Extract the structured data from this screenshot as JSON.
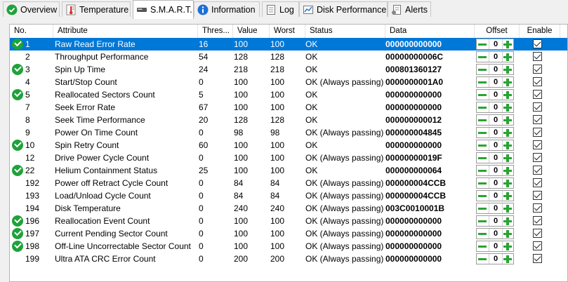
{
  "tabs": [
    {
      "label": "Overview",
      "icon": "green-check-icon"
    },
    {
      "label": "Temperature",
      "icon": "thermometer-icon"
    },
    {
      "label": "S.M.A.R.T.",
      "icon": "drive-icon",
      "active": true
    },
    {
      "label": "Information",
      "icon": "info-icon"
    },
    {
      "label": "Log",
      "icon": "log-icon"
    },
    {
      "label": "Disk Performance",
      "icon": "chart-icon"
    },
    {
      "label": "Alerts",
      "icon": "alerts-icon"
    }
  ],
  "columns": [
    "No.",
    "Attribute",
    "Thres...",
    "Value",
    "Worst",
    "Status",
    "Data",
    "Offset",
    "Enable"
  ],
  "rows": [
    {
      "no": "1",
      "attribute": "Raw Read Error Rate",
      "threshold": "16",
      "value": "100",
      "worst": "100",
      "status": "OK",
      "data": "000000000000",
      "offset": "0",
      "check": true
    },
    {
      "no": "2",
      "attribute": "Throughput Performance",
      "threshold": "54",
      "value": "128",
      "worst": "128",
      "status": "OK",
      "data": "00000000006C",
      "offset": "0",
      "check": false
    },
    {
      "no": "3",
      "attribute": "Spin Up Time",
      "threshold": "24",
      "value": "218",
      "worst": "218",
      "status": "OK",
      "data": "000801360127",
      "offset": "0",
      "check": true
    },
    {
      "no": "4",
      "attribute": "Start/Stop Count",
      "threshold": "0",
      "value": "100",
      "worst": "100",
      "status": "OK (Always passing)",
      "data": "0000000001A0",
      "offset": "0",
      "check": false
    },
    {
      "no": "5",
      "attribute": "Reallocated Sectors Count",
      "threshold": "5",
      "value": "100",
      "worst": "100",
      "status": "OK",
      "data": "000000000000",
      "offset": "0",
      "check": true
    },
    {
      "no": "7",
      "attribute": "Seek Error Rate",
      "threshold": "67",
      "value": "100",
      "worst": "100",
      "status": "OK",
      "data": "000000000000",
      "offset": "0",
      "check": false
    },
    {
      "no": "8",
      "attribute": "Seek Time Performance",
      "threshold": "20",
      "value": "128",
      "worst": "128",
      "status": "OK",
      "data": "000000000012",
      "offset": "0",
      "check": false
    },
    {
      "no": "9",
      "attribute": "Power On Time Count",
      "threshold": "0",
      "value": "98",
      "worst": "98",
      "status": "OK (Always passing)",
      "data": "000000004845",
      "offset": "0",
      "check": false
    },
    {
      "no": "10",
      "attribute": "Spin Retry Count",
      "threshold": "60",
      "value": "100",
      "worst": "100",
      "status": "OK",
      "data": "000000000000",
      "offset": "0",
      "check": true
    },
    {
      "no": "12",
      "attribute": "Drive Power Cycle Count",
      "threshold": "0",
      "value": "100",
      "worst": "100",
      "status": "OK (Always passing)",
      "data": "00000000019F",
      "offset": "0",
      "check": false
    },
    {
      "no": "22",
      "attribute": "Helium Containment Status",
      "threshold": "25",
      "value": "100",
      "worst": "100",
      "status": "OK",
      "data": "000000000064",
      "offset": "0",
      "check": true
    },
    {
      "no": "192",
      "attribute": "Power off Retract Cycle Count",
      "threshold": "0",
      "value": "84",
      "worst": "84",
      "status": "OK (Always passing)",
      "data": "000000004CCB",
      "offset": "0",
      "check": false
    },
    {
      "no": "193",
      "attribute": "Load/Unload Cycle Count",
      "threshold": "0",
      "value": "84",
      "worst": "84",
      "status": "OK (Always passing)",
      "data": "000000004CCB",
      "offset": "0",
      "check": false
    },
    {
      "no": "194",
      "attribute": "Disk Temperature",
      "threshold": "0",
      "value": "240",
      "worst": "240",
      "status": "OK (Always passing)",
      "data": "003C0010001B",
      "offset": "0",
      "check": false
    },
    {
      "no": "196",
      "attribute": "Reallocation Event Count",
      "threshold": "0",
      "value": "100",
      "worst": "100",
      "status": "OK (Always passing)",
      "data": "000000000000",
      "offset": "0",
      "check": true
    },
    {
      "no": "197",
      "attribute": "Current Pending Sector Count",
      "threshold": "0",
      "value": "100",
      "worst": "100",
      "status": "OK (Always passing)",
      "data": "000000000000",
      "offset": "0",
      "check": true
    },
    {
      "no": "198",
      "attribute": "Off-Line Uncorrectable Sector Count",
      "threshold": "0",
      "value": "100",
      "worst": "100",
      "status": "OK (Always passing)",
      "data": "000000000000",
      "offset": "0",
      "check": true
    },
    {
      "no": "199",
      "attribute": "Ultra ATA CRC Error Count",
      "threshold": "0",
      "value": "200",
      "worst": "200",
      "status": "OK (Always passing)",
      "data": "000000000000",
      "offset": "0",
      "check": false
    }
  ],
  "colors": {
    "selection": "#0078d7",
    "ok_green": "#1fa23a",
    "stepper_green": "#2aa334"
  }
}
